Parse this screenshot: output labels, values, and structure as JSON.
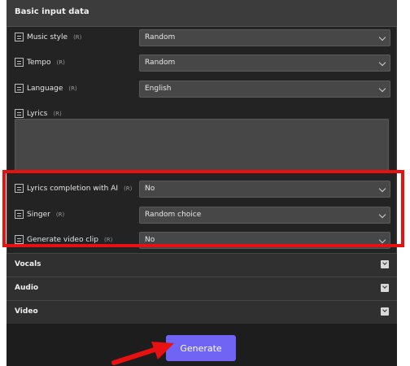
{
  "header": {
    "title": "Basic input data"
  },
  "fields": [
    {
      "label": "Music style",
      "tag": "(R)",
      "value": "Random"
    },
    {
      "label": "Tempo",
      "tag": "(R)",
      "value": "Random"
    },
    {
      "label": "Language",
      "tag": "(R)",
      "value": "English"
    }
  ],
  "lyrics": {
    "label": "Lyrics",
    "tag": "(R)",
    "value": ""
  },
  "highlighted_fields": [
    {
      "label": "Lyrics completion with AI",
      "tag": "(R)",
      "value": "No"
    },
    {
      "label": "Singer",
      "tag": "(R)",
      "value": "Random choice"
    },
    {
      "label": "Generate video clip",
      "tag": "(R)",
      "value": "No"
    }
  ],
  "sections": [
    {
      "title": "Vocals"
    },
    {
      "title": "Audio"
    },
    {
      "title": "Video"
    }
  ],
  "actions": {
    "generate": "Generate"
  },
  "colors": {
    "accent": "#6f64f4",
    "highlight": "#e81010"
  }
}
